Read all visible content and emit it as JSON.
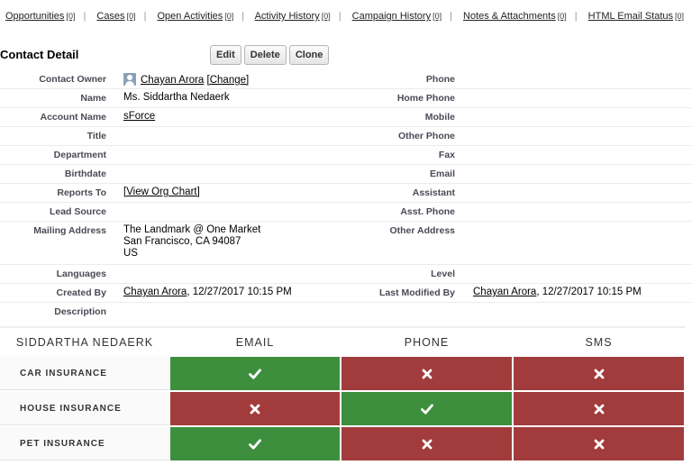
{
  "related_links": [
    {
      "label": "Opportunities",
      "count": "[0]"
    },
    {
      "label": "Cases",
      "count": "[0]"
    },
    {
      "label": "Open Activities",
      "count": "[0]"
    },
    {
      "label": "Activity History",
      "count": "[0]"
    },
    {
      "label": "Campaign History",
      "count": "[0]"
    },
    {
      "label": "Notes & Attachments",
      "count": "[0]"
    },
    {
      "label": "HTML Email Status",
      "count": "[0]"
    }
  ],
  "separator": "|",
  "header": {
    "title": "Contact Detail",
    "edit_label": "Edit",
    "delete_label": "Delete",
    "clone_label": "Clone"
  },
  "fields": {
    "contact_owner": {
      "label": "Contact Owner",
      "value": "Chayan Arora",
      "change": "[Change]"
    },
    "phone": {
      "label": "Phone",
      "value": ""
    },
    "name": {
      "label": "Name",
      "value": "Ms. Siddartha Nedaerk"
    },
    "home_phone": {
      "label": "Home Phone",
      "value": ""
    },
    "account_name": {
      "label": "Account Name",
      "value": "sForce"
    },
    "mobile": {
      "label": "Mobile",
      "value": ""
    },
    "title": {
      "label": "Title",
      "value": ""
    },
    "other_phone": {
      "label": "Other Phone",
      "value": ""
    },
    "department": {
      "label": "Department",
      "value": ""
    },
    "fax": {
      "label": "Fax",
      "value": ""
    },
    "birthdate": {
      "label": "Birthdate",
      "value": ""
    },
    "email": {
      "label": "Email",
      "value": ""
    },
    "reports_to": {
      "label": "Reports To",
      "value": "[View Org Chart]"
    },
    "assistant": {
      "label": "Assistant",
      "value": ""
    },
    "lead_source": {
      "label": "Lead Source",
      "value": ""
    },
    "asst_phone": {
      "label": "Asst. Phone",
      "value": ""
    },
    "mailing_address": {
      "label": "Mailing Address",
      "lines": [
        "The Landmark @ One Market",
        "San Francisco, CA 94087",
        "US"
      ]
    },
    "other_address": {
      "label": "Other Address",
      "value": ""
    },
    "languages": {
      "label": "Languages",
      "value": ""
    },
    "level": {
      "label": "Level",
      "value": ""
    },
    "created_by": {
      "label": "Created By",
      "user": "Chayan Arora",
      "timestamp": ", 12/27/2017 10:15 PM"
    },
    "last_modified_by": {
      "label": "Last Modified By",
      "user": "Chayan Arora",
      "timestamp": ", 12/27/2017 10:15 PM"
    },
    "description": {
      "label": "Description",
      "value": ""
    }
  },
  "matrix": {
    "corner": "SIDDARTHA NEDAERK",
    "columns": [
      "EMAIL",
      "PHONE",
      "SMS"
    ],
    "rows": [
      {
        "label": "CAR INSURANCE",
        "cells": [
          "check",
          "cross",
          "cross"
        ]
      },
      {
        "label": "HOUSE INSURANCE",
        "cells": [
          "cross",
          "check",
          "cross"
        ]
      },
      {
        "label": "PET INSURANCE",
        "cells": [
          "check",
          "cross",
          "cross"
        ]
      }
    ],
    "colors": {
      "check": "#3d8f3d",
      "cross": "#a23c3c"
    },
    "icons": {
      "check": "check-icon",
      "cross": "cross-icon"
    }
  }
}
